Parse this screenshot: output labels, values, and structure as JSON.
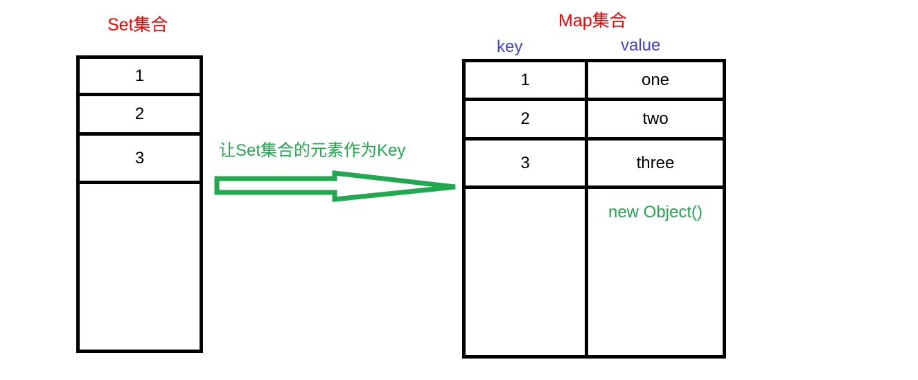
{
  "diagram": {
    "type": "set-to-map-concept-diagram",
    "set_panel": {
      "title": "Set集合",
      "title_color": "#FF0000",
      "rows": [
        "1",
        "2",
        "3",
        ""
      ]
    },
    "map_panel": {
      "title": "Map集合",
      "title_color": "#FF0000",
      "column_headers": {
        "key": "key",
        "value": "value",
        "color": "#4342D6"
      },
      "rows": [
        {
          "key": "1",
          "value": "one",
          "value_color": "#000000"
        },
        {
          "key": "2",
          "value": "two",
          "value_color": "#000000"
        },
        {
          "key": "3",
          "value": "three",
          "value_color": "#000000"
        },
        {
          "key": "",
          "value": "new Object()",
          "value_color": "#22A84F"
        }
      ]
    },
    "arrow": {
      "label": "让Set集合的元素作为Key",
      "color": "#22A84F",
      "direction": "left-to-right",
      "icon": "block-arrow-right"
    }
  }
}
